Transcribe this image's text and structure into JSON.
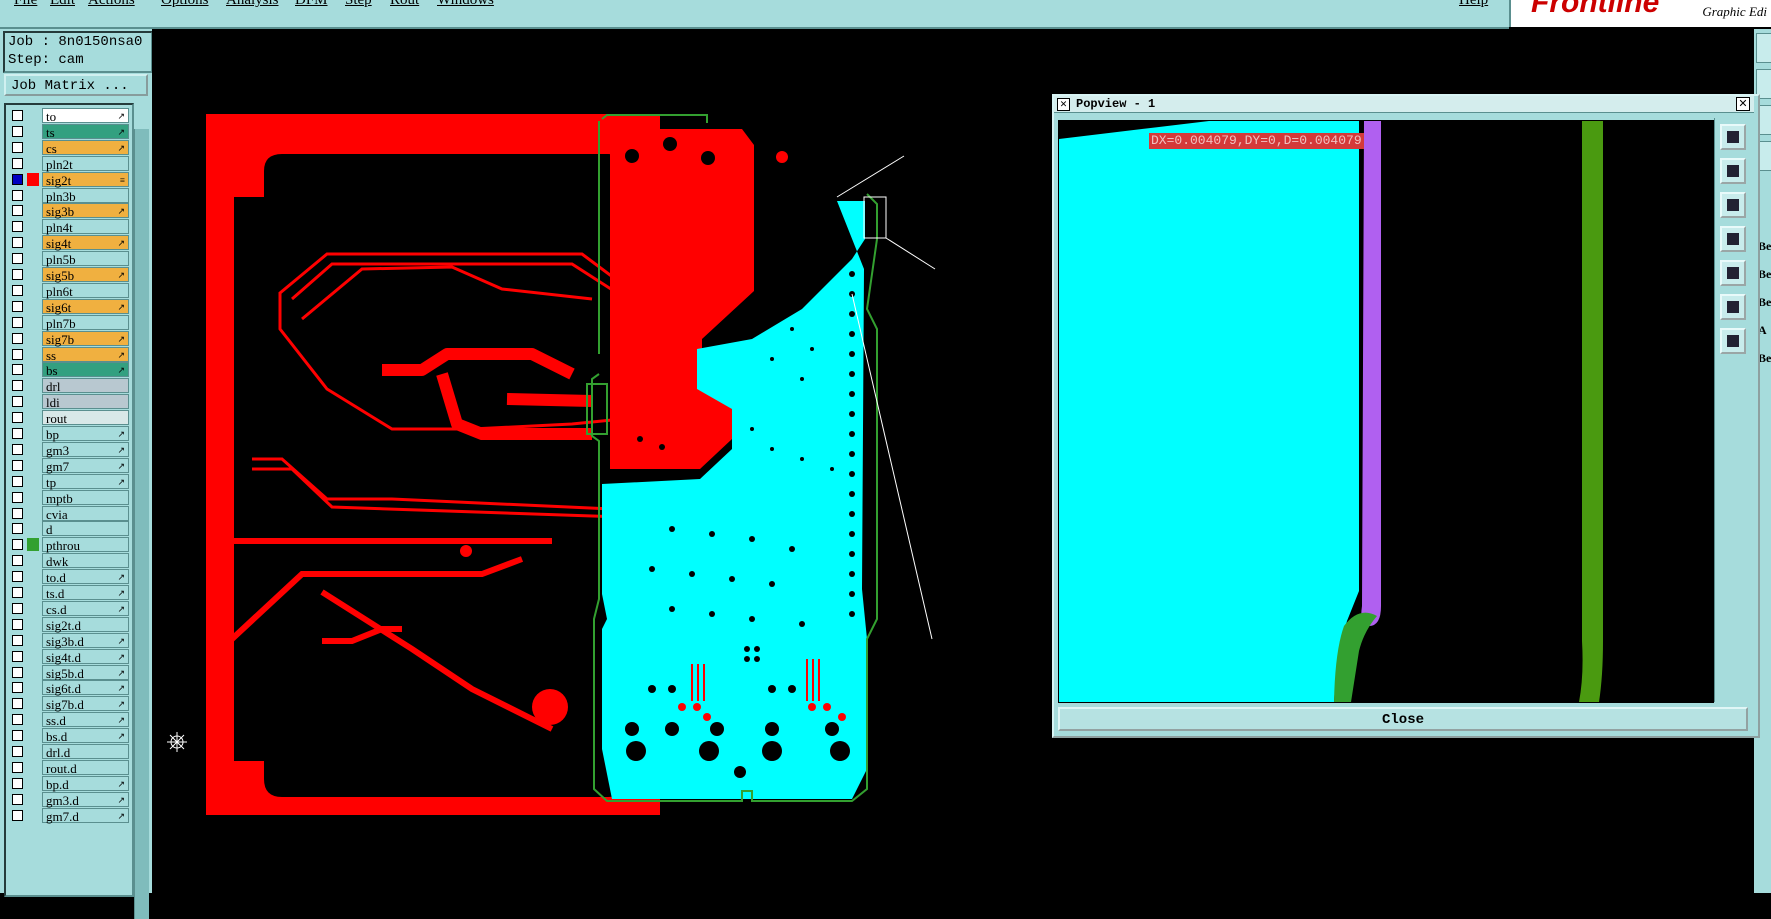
{
  "menu": {
    "items": [
      "File",
      "Edit",
      "Actions",
      "Options",
      "Analysis",
      "DFM",
      "Step",
      "Rout",
      "Windows"
    ],
    "help": "Help"
  },
  "brand": {
    "logo": "Frontline",
    "subtitle": "Graphic Edi"
  },
  "job": {
    "job_line": "Job : 8n0150nsa0",
    "step_line": "Step: cam"
  },
  "job_matrix_button": "Job Matrix ...",
  "layers": [
    {
      "name": "to",
      "color": "#ffffff",
      "mark": "↗"
    },
    {
      "name": "ts",
      "color": "#33a080",
      "mark": "↗"
    },
    {
      "name": "cs",
      "color": "#f0b040",
      "mark": "↗"
    },
    {
      "name": "pln2t",
      "color": "#a6dcdc",
      "mark": ""
    },
    {
      "name": "sig2t",
      "color": "#f0b040",
      "mark": "≡",
      "active": true
    },
    {
      "name": "pln3b",
      "color": "#a6dcdc",
      "mark": ""
    },
    {
      "name": "sig3b",
      "color": "#f0b040",
      "mark": "↗"
    },
    {
      "name": "pln4t",
      "color": "#a6dcdc",
      "mark": ""
    },
    {
      "name": "sig4t",
      "color": "#f0b040",
      "mark": "↗"
    },
    {
      "name": "pln5b",
      "color": "#a6dcdc",
      "mark": ""
    },
    {
      "name": "sig5b",
      "color": "#f0b040",
      "mark": "↗"
    },
    {
      "name": "pln6t",
      "color": "#a6dcdc",
      "mark": ""
    },
    {
      "name": "sig6t",
      "color": "#f0b040",
      "mark": "↗"
    },
    {
      "name": "pln7b",
      "color": "#a6dcdc",
      "mark": ""
    },
    {
      "name": "sig7b",
      "color": "#f0b040",
      "mark": "↗"
    },
    {
      "name": "ss",
      "color": "#f0b040",
      "mark": "↗"
    },
    {
      "name": "bs",
      "color": "#33a080",
      "mark": "↗"
    },
    {
      "name": "drl",
      "color": "#b8c8d0",
      "mark": ""
    },
    {
      "name": "ldi",
      "color": "#b8c8d0",
      "mark": ""
    },
    {
      "name": "rout",
      "color": "#d8e8e8",
      "mark": ""
    },
    {
      "name": "bp",
      "color": "#a6dcdc",
      "mark": "↗"
    },
    {
      "name": "gm3",
      "color": "#a6dcdc",
      "mark": "↗"
    },
    {
      "name": "gm7",
      "color": "#a6dcdc",
      "mark": "↗"
    },
    {
      "name": "tp",
      "color": "#a6dcdc",
      "mark": "↗"
    },
    {
      "name": "mptb",
      "color": "#a6dcdc",
      "mark": ""
    },
    {
      "name": "cvia",
      "color": "#a6dcdc",
      "mark": ""
    },
    {
      "name": "d",
      "color": "#a6dcdc",
      "mark": ""
    },
    {
      "name": "pthrou",
      "color": "#a6dcdc",
      "mark": "",
      "swatch": "#33a030"
    },
    {
      "name": "dwk",
      "color": "#a6dcdc",
      "mark": ""
    },
    {
      "name": "to.d",
      "color": "#a6dcdc",
      "mark": "↗"
    },
    {
      "name": "ts.d",
      "color": "#a6dcdc",
      "mark": "↗"
    },
    {
      "name": "cs.d",
      "color": "#a6dcdc",
      "mark": "↗"
    },
    {
      "name": "sig2t.d",
      "color": "#a6dcdc",
      "mark": ""
    },
    {
      "name": "sig3b.d",
      "color": "#a6dcdc",
      "mark": "↗"
    },
    {
      "name": "sig4t.d",
      "color": "#a6dcdc",
      "mark": "↗"
    },
    {
      "name": "sig5b.d",
      "color": "#a6dcdc",
      "mark": "↗"
    },
    {
      "name": "sig6t.d",
      "color": "#a6dcdc",
      "mark": "↗"
    },
    {
      "name": "sig7b.d",
      "color": "#a6dcdc",
      "mark": "↗"
    },
    {
      "name": "ss.d",
      "color": "#a6dcdc",
      "mark": "↗"
    },
    {
      "name": "bs.d",
      "color": "#a6dcdc",
      "mark": "↗"
    },
    {
      "name": "drl.d",
      "color": "#a6dcdc",
      "mark": ""
    },
    {
      "name": "rout.d",
      "color": "#a6dcdc",
      "mark": ""
    },
    {
      "name": "bp.d",
      "color": "#a6dcdc",
      "mark": "↗"
    },
    {
      "name": "gm3.d",
      "color": "#a6dcdc",
      "mark": "↗"
    },
    {
      "name": "gm7.d",
      "color": "#a6dcdc",
      "mark": "↗"
    }
  ],
  "right_strip_labels": [
    "Be",
    "Be",
    "Be",
    "A",
    "Be"
  ],
  "popview": {
    "title": "Popview - 1",
    "measurement": "DX=0.004079,DY=0,D=0.004079",
    "close_label": "Close"
  },
  "colors": {
    "panel": "#a6dcdc",
    "copper": "#ff0000",
    "plane": "#00ffff",
    "outline": "#33a030",
    "purple": "#b060f0"
  }
}
